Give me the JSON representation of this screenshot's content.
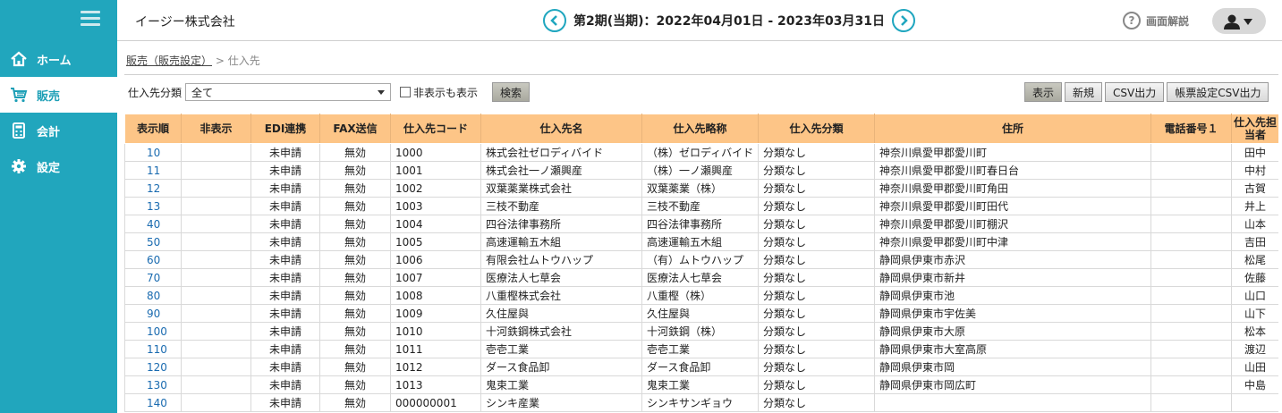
{
  "sidebar": {
    "items": [
      {
        "label": "ホーム",
        "icon": "home-icon"
      },
      {
        "label": "販売",
        "icon": "cart-icon",
        "active": true
      },
      {
        "label": "会計",
        "icon": "calculator-icon"
      },
      {
        "label": "設定",
        "icon": "gear-icon"
      }
    ]
  },
  "header": {
    "company": "イージー株式会社",
    "period": "第2期(当期)：2022年04月01日 - 2023年03月31日",
    "help_label": "画面解説",
    "help_icon": "?"
  },
  "breadcrumb": {
    "link": "販売（販売設定）",
    "separator": " > ",
    "current": "仕入先"
  },
  "filter": {
    "category_label": "仕入先分類",
    "category_value": "全て",
    "show_hidden_label": "非表示も表示",
    "search_label": "検索"
  },
  "actions": {
    "show": "表示",
    "new": "新規",
    "csv": "CSV出力",
    "form_csv": "帳票設定CSV出力"
  },
  "table": {
    "headers": [
      "表示順",
      "非表示",
      "EDI連携",
      "FAX送信",
      "仕入先コード",
      "仕入先名",
      "仕入先略称",
      "仕入先分類",
      "住所",
      "電話番号１",
      "仕入先担当者"
    ],
    "rows": [
      [
        "10",
        "",
        "未申請",
        "無効",
        "1000",
        "株式会社ゼロディバイド",
        "（株）ゼロディバイド",
        "分類なし",
        "神奈川県愛甲郡愛川町",
        "",
        "田中"
      ],
      [
        "11",
        "",
        "未申請",
        "無効",
        "1001",
        "株式会社一ノ瀬興産",
        "（株）一ノ瀬興産",
        "分類なし",
        "神奈川県愛甲郡愛川町春日台",
        "",
        "中村"
      ],
      [
        "12",
        "",
        "未申請",
        "無効",
        "1002",
        "双葉薬業株式会社",
        "双葉薬業（株）",
        "分類なし",
        "神奈川県愛甲郡愛川町角田",
        "",
        "古賀"
      ],
      [
        "13",
        "",
        "未申請",
        "無効",
        "1003",
        "三枝不動産",
        "三枝不動産",
        "分類なし",
        "神奈川県愛甲郡愛川町田代",
        "",
        "井上"
      ],
      [
        "40",
        "",
        "未申請",
        "無効",
        "1004",
        "四谷法律事務所",
        "四谷法律事務所",
        "分類なし",
        "神奈川県愛甲郡愛川町棚沢",
        "",
        "山本"
      ],
      [
        "50",
        "",
        "未申請",
        "無効",
        "1005",
        "高速運輸五木組",
        "高速運輸五木組",
        "分類なし",
        "神奈川県愛甲郡愛川町中津",
        "",
        "吉田"
      ],
      [
        "60",
        "",
        "未申請",
        "無効",
        "1006",
        "有限会社ムトウハップ",
        "（有）ムトウハップ",
        "分類なし",
        "静岡県伊東市赤沢",
        "",
        "松尾"
      ],
      [
        "70",
        "",
        "未申請",
        "無効",
        "1007",
        "医療法人七草会",
        "医療法人七草会",
        "分類なし",
        "静岡県伊東市新井",
        "",
        "佐藤"
      ],
      [
        "80",
        "",
        "未申請",
        "無効",
        "1008",
        "八重樫株式会社",
        "八重樫（株）",
        "分類なし",
        "静岡県伊東市池",
        "",
        "山口"
      ],
      [
        "90",
        "",
        "未申請",
        "無効",
        "1009",
        "久住屋與",
        "久住屋與",
        "分類なし",
        "静岡県伊東市宇佐美",
        "",
        "山下"
      ],
      [
        "100",
        "",
        "未申請",
        "無効",
        "1010",
        "十河鉄鋼株式会社",
        "十河鉄鋼（株）",
        "分類なし",
        "静岡県伊東市大原",
        "",
        "松本"
      ],
      [
        "110",
        "",
        "未申請",
        "無効",
        "1011",
        "壱壱工業",
        "壱壱工業",
        "分類なし",
        "静岡県伊東市大室高原",
        "",
        "渡辺"
      ],
      [
        "120",
        "",
        "未申請",
        "無効",
        "1012",
        "ダース食品卸",
        "ダース食品卸",
        "分類なし",
        "静岡県伊東市岡",
        "",
        "山田"
      ],
      [
        "130",
        "",
        "未申請",
        "無効",
        "1013",
        "鬼束工業",
        "鬼束工業",
        "分類なし",
        "静岡県伊東市岡広町",
        "",
        "中島"
      ],
      [
        "140",
        "",
        "未申請",
        "無効",
        "000000001",
        "シンキ産業",
        "シンキサンギョウ",
        "分類なし",
        "",
        "",
        ""
      ]
    ]
  }
}
